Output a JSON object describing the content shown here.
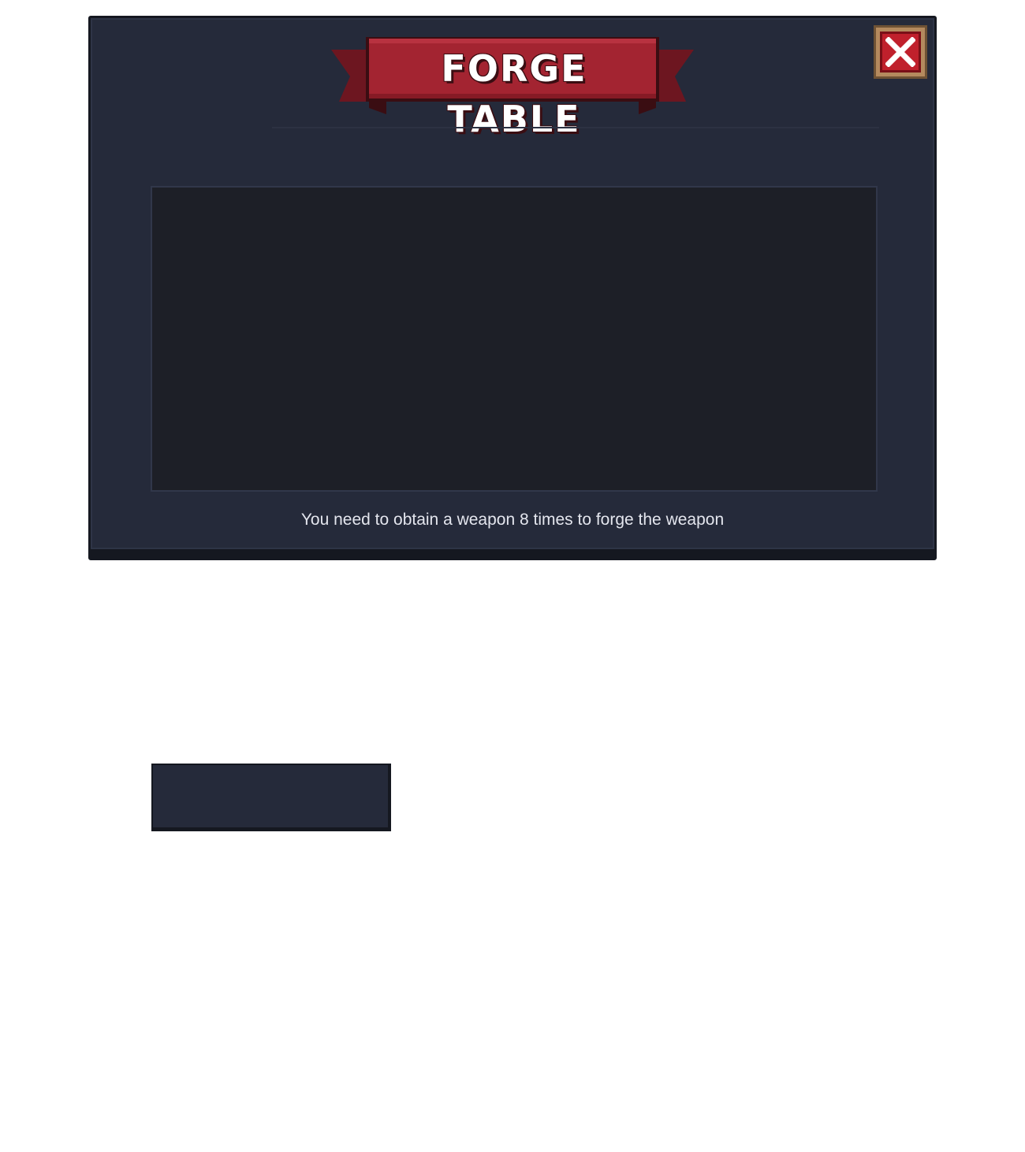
{
  "window": {
    "title": "FORGE TABLE",
    "close_icon": "close-icon",
    "info_text": "You need to obtain a weapon 8 times to forge the weapon"
  },
  "colors": {
    "panel_bg": "#252a3a",
    "panel_border": "#151820",
    "content_bg": "#1d1f27",
    "banner_red": "#a32431",
    "banner_dark_red": "#6d1620",
    "close_red": "#c0202c",
    "close_frame": "#b48a5e",
    "text": "#e4e6ee"
  },
  "secondary_button": {
    "label": ""
  }
}
